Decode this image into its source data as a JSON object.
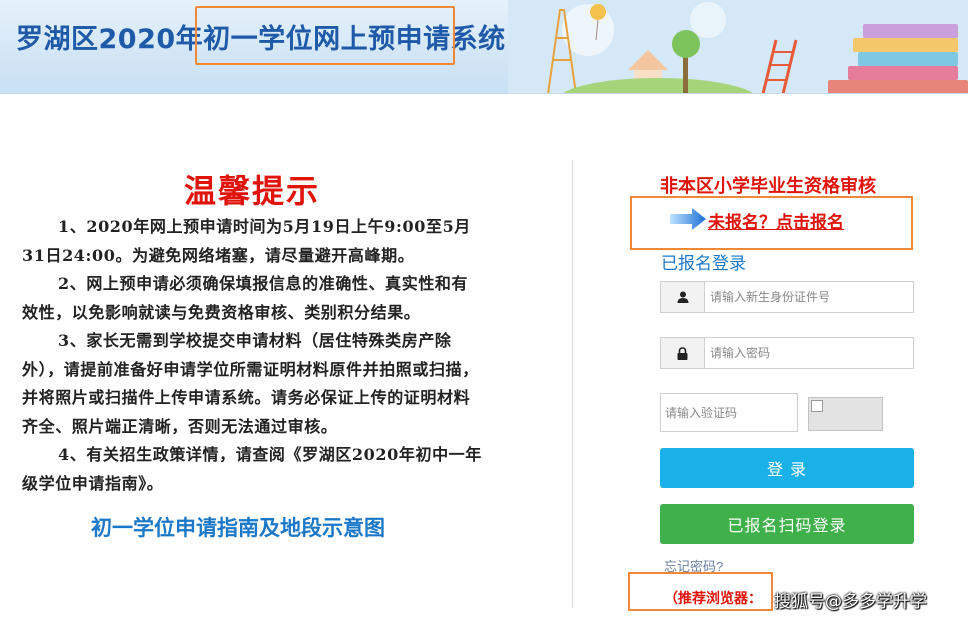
{
  "header": {
    "title": "罗湖区2020年初一学位网上预申请系统",
    "colors": {
      "title": "#1e5aa8",
      "highlight_box": "#f0883a"
    }
  },
  "notice": {
    "title": "温馨提示",
    "items": [
      "1、2020年网上预申请时间为5月19日上午9:00至5月31日24:00。为避免网络堵塞，请尽量避开高峰期。",
      "2、网上预申请必须确保填报信息的准确性、真实性和有效性，以免影响就读与免费资格审核、类别积分结果。",
      "3、家长无需到学校提交申请材料（居住特殊类房产除外），请提前准备好申请学位所需证明材料原件并拍照或扫描，并将照片或扫描件上传申请系统。请务必保证上传的证明材料齐全、照片端正清晰，否则无法通过审核。",
      "4、有关招生政策详情，请查阅《罗湖区2020年初中一年级学位申请指南》。"
    ],
    "guide_link": "初一学位申请指南及地段示意图"
  },
  "login": {
    "nonlocal_title": "非本区小学毕业生资格审核",
    "register_link": "未报名？点击报名",
    "registered_login": "已报名登录",
    "id_placeholder": "请输入新生身份证件号",
    "password_placeholder": "请输入密码",
    "captcha_placeholder": "请输入验证码",
    "login_button": "登 录",
    "qr_login_button": "已报名扫码登录",
    "forgot_password": "忘记密码?",
    "browser_note": "（推荐浏览器：",
    "icons": [
      "arrow-right-icon",
      "user-icon",
      "lock-icon",
      "broken-image-icon"
    ],
    "colors": {
      "login_button": "#1ab0e8",
      "qr_button": "#3fb04a",
      "red_text": "#e0140b",
      "link_blue": "#1b78c8"
    }
  },
  "watermark": "搜狐号@多多学升学"
}
